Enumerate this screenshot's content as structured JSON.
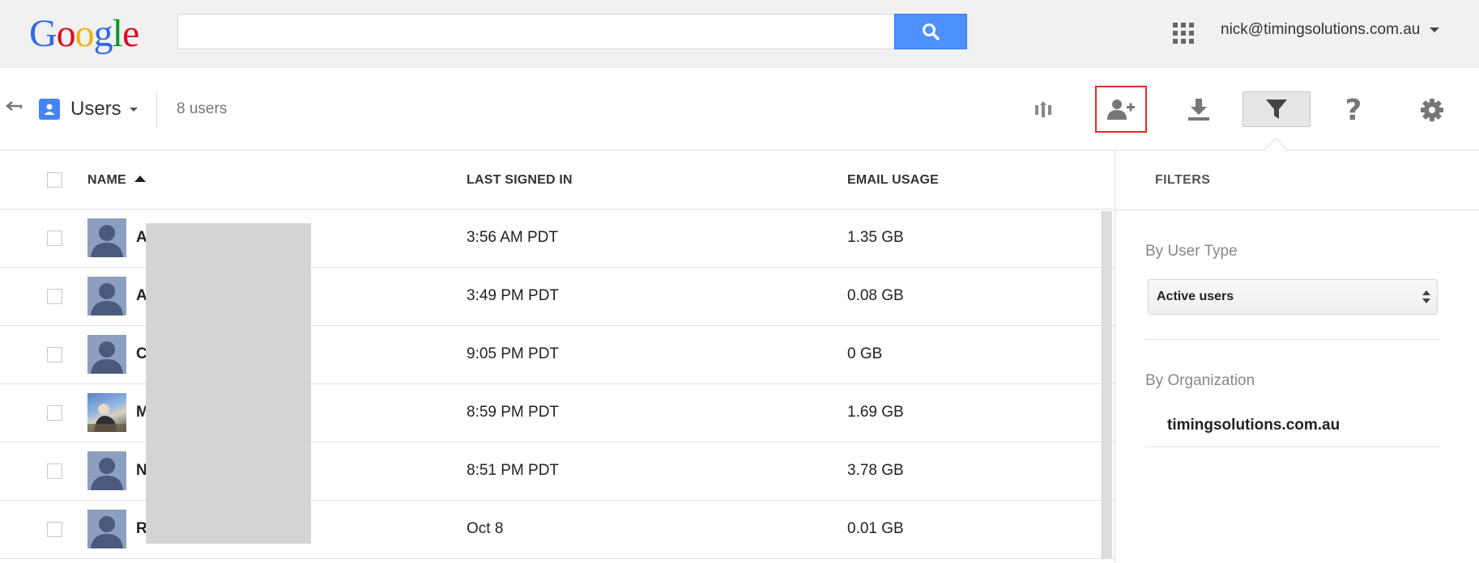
{
  "header": {
    "logo_letters": [
      {
        "char": "G",
        "color": "#3369e8"
      },
      {
        "char": "o",
        "color": "#d50f25"
      },
      {
        "char": "o",
        "color": "#eeb211"
      },
      {
        "char": "g",
        "color": "#3369e8"
      },
      {
        "char": "l",
        "color": "#009925"
      },
      {
        "char": "e",
        "color": "#d50f25"
      }
    ],
    "search_value": "",
    "account_email": "nick@timingsolutions.com.au"
  },
  "toolbar": {
    "section_title": "Users",
    "user_count": "8 users",
    "help_glyph": "?"
  },
  "table": {
    "columns": {
      "name": "NAME",
      "last_signed_in": "LAST SIGNED IN",
      "email_usage": "EMAIL USAGE"
    },
    "rows": [
      {
        "initial": "A",
        "last_signed_in": "3:56 AM PDT",
        "email_usage": "1.35 GB",
        "photo": false
      },
      {
        "initial": "A",
        "last_signed_in": "3:49 PM PDT",
        "email_usage": "0.08 GB",
        "photo": false
      },
      {
        "initial": "C",
        "last_signed_in": "9:05 PM PDT",
        "email_usage": "0 GB",
        "photo": false
      },
      {
        "initial": "M",
        "last_signed_in": "8:59 PM PDT",
        "email_usage": "1.69 GB",
        "photo": true
      },
      {
        "initial": "N",
        "last_signed_in": "8:51 PM PDT",
        "email_usage": "3.78 GB",
        "photo": false
      },
      {
        "initial": "R",
        "last_signed_in": "Oct 8",
        "email_usage": "0.01 GB",
        "photo": false
      }
    ]
  },
  "filters": {
    "title": "FILTERS",
    "by_user_type_label": "By User Type",
    "user_type_selected": "Active users",
    "by_organization_label": "By Organization",
    "organization": "timingsolutions.com.au"
  },
  "colors": {
    "search_button": "#4d90fe",
    "users_badge": "#4285f4",
    "add_user_highlight": "#dd2b2b"
  }
}
